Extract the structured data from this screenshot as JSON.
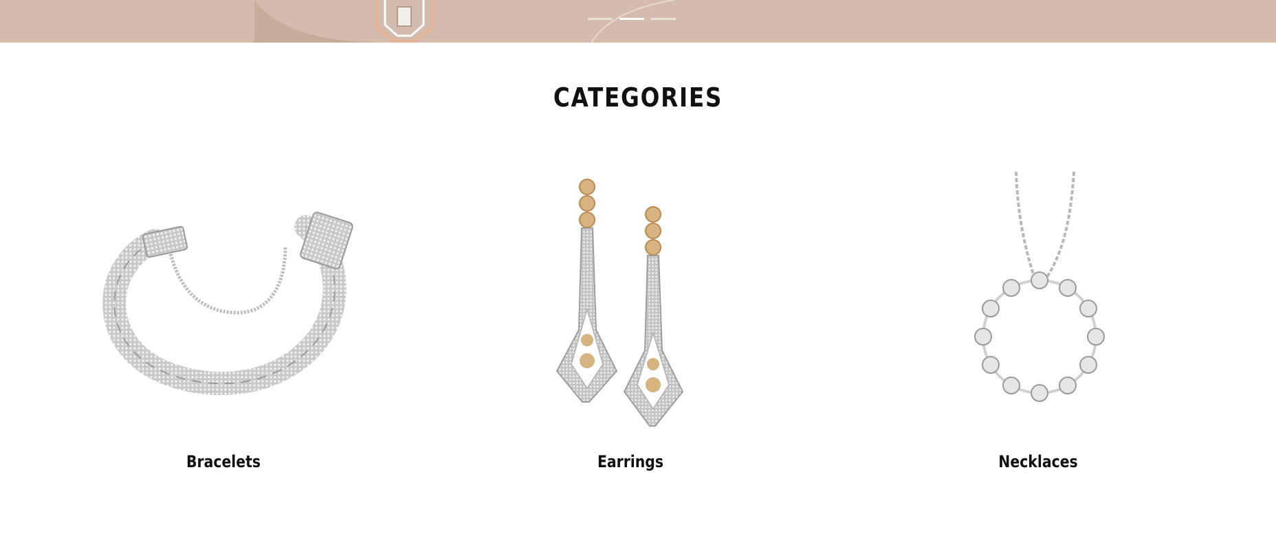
{
  "hero": {
    "slides": [
      {
        "active": false
      },
      {
        "active": true
      },
      {
        "active": false
      }
    ],
    "background_color": "#d3bcad"
  },
  "categories": {
    "title": "CATEGORIES",
    "items": [
      {
        "label": "Bracelets",
        "icon": "bracelet-image"
      },
      {
        "label": "Earrings",
        "icon": "earrings-image"
      },
      {
        "label": "Necklaces",
        "icon": "necklace-image"
      }
    ]
  }
}
